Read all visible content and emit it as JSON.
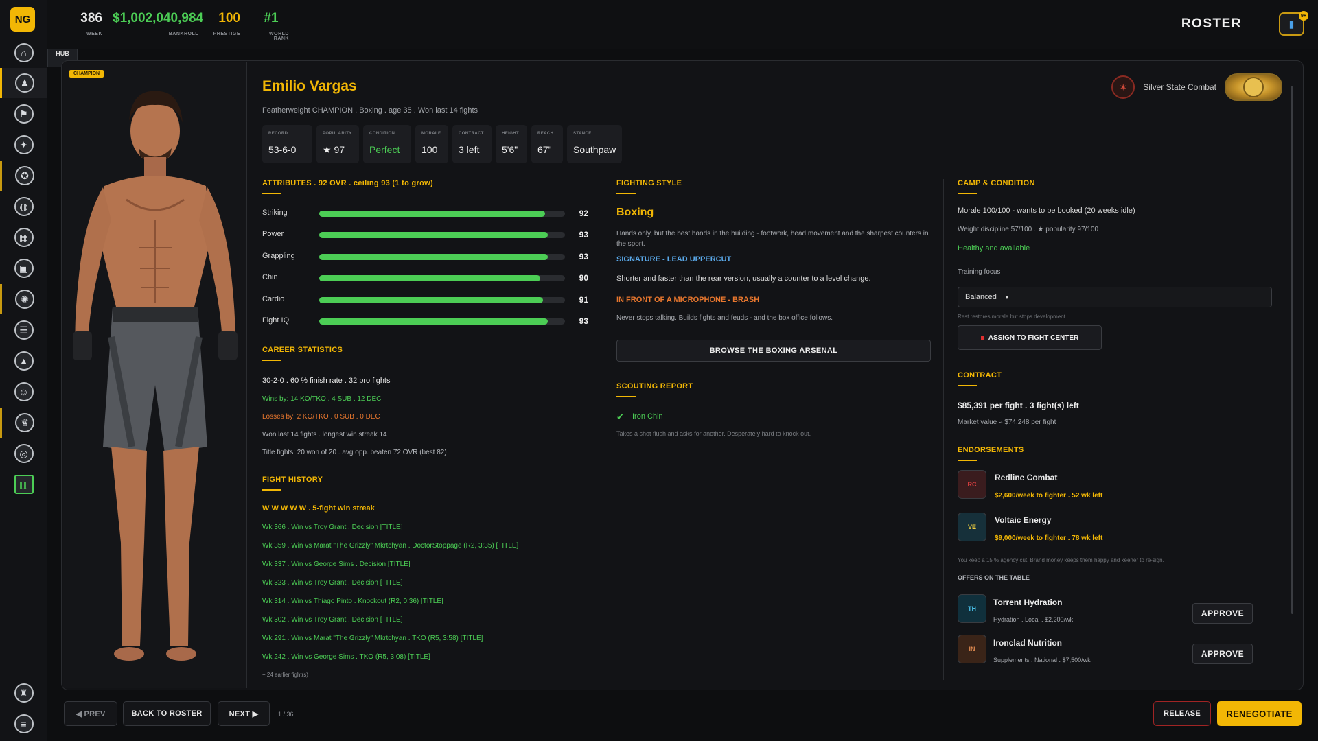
{
  "app": {
    "logo": "NG"
  },
  "topbar": {
    "stats": [
      {
        "value": "386",
        "label": "WEEK",
        "color": "#f0f0f0"
      },
      {
        "value": "$1,002,040,984",
        "label": "BANKROLL",
        "color": "#4ccd55"
      },
      {
        "value": "100",
        "label": "PRESTIGE",
        "color": "#f2b705"
      },
      {
        "value": "#1",
        "label": "WORLD RANK",
        "color": "#4ccd55"
      }
    ],
    "page_title": "ROSTER",
    "roster_badge": "9+"
  },
  "sidebar": {
    "hub_tooltip": "HUB",
    "items": [
      "hub",
      "roster",
      "gym",
      "fighters",
      "events",
      "world",
      "facilities",
      "media",
      "sponsors",
      "rankings",
      "stats",
      "staff",
      "trophies",
      "records",
      "analytics",
      "office",
      "menu"
    ]
  },
  "fighter": {
    "champion_tag": "CHAMPION",
    "name": "Emilio Vargas",
    "subtitle": "Featherweight CHAMPION . Boxing . age 35 . Won last 14 fights",
    "badges": [
      {
        "label": "RECORD",
        "value": "53-6-0"
      },
      {
        "label": "POPULARITY",
        "value": "★ 97"
      },
      {
        "label": "CONDITION",
        "value": "Perfect"
      },
      {
        "label": "MORALE",
        "value": "100"
      },
      {
        "label": "CONTRACT",
        "value": "3 left"
      },
      {
        "label": "HEIGHT",
        "value": "5'6\""
      },
      {
        "label": "REACH",
        "value": "67\""
      },
      {
        "label": "STANCE",
        "value": "Southpaw"
      }
    ],
    "org": "Silver State Combat"
  },
  "attributes": {
    "title": "ATTRIBUTES . 92 OVR . ceiling 93 (1 to grow)",
    "rows": [
      {
        "name": "Striking",
        "value": "92",
        "pct": 92
      },
      {
        "name": "Power",
        "value": "93",
        "pct": 93
      },
      {
        "name": "Grappling",
        "value": "93",
        "pct": 93
      },
      {
        "name": "Chin",
        "value": "90",
        "pct": 90
      },
      {
        "name": "Cardio",
        "value": "91",
        "pct": 91
      },
      {
        "name": "Fight IQ",
        "value": "93",
        "pct": 93
      }
    ]
  },
  "career": {
    "title": "CAREER STATISTICS",
    "line1": "30-2-0 . 60 % finish rate . 32 pro fights",
    "wins": "Wins by: 14 KO/TKO . 4 SUB . 12 DEC",
    "losses": "Losses by: 2 KO/TKO . 0 SUB . 0 DEC",
    "streak": "Won last 14 fights . longest win streak 14",
    "titles": "Title fights: 20 won of 20 . avg opp. beaten 72 OVR (best 82)"
  },
  "history": {
    "title": "FIGHT HISTORY",
    "summary": "W W W W W . 5-fight win streak",
    "fights": [
      "Wk 366 . Win vs Troy Grant . Decision [TITLE]",
      "Wk 359 . Win vs Marat \"The Grizzly\" Mkrtchyan . DoctorStoppage (R2, 3:35) [TITLE]",
      "Wk 337 . Win vs George Sims . Decision [TITLE]",
      "Wk 323 . Win vs Troy Grant . Decision [TITLE]",
      "Wk 314 . Win vs Thiago Pinto . Knockout (R2, 0:36) [TITLE]",
      "Wk 302 . Win vs Troy Grant . Decision [TITLE]",
      "Wk 291 . Win vs Marat \"The Grizzly\" Mkrtchyan . TKO (R5, 3:58) [TITLE]",
      "Wk 242 . Win vs George Sims . TKO (R5, 3:08) [TITLE]"
    ],
    "more": "+ 24 earlier fight(s)"
  },
  "style": {
    "title": "FIGHTING STYLE",
    "name": "Boxing",
    "desc": "Hands only, but the best hands in the building - footwork, head movement and the sharpest counters in the sport.",
    "signature_title": "SIGNATURE - LEAD UPPERCUT",
    "signature_desc": "Shorter and faster than the rear version, usually a counter to a level change.",
    "trait_title": "IN FRONT OF A MICROPHONE - BRASH",
    "trait_desc": "Never stops talking. Builds fights and feuds - and the box office follows.",
    "arsenal_button": "BROWSE THE BOXING ARSENAL"
  },
  "scouting": {
    "title": "SCOUTING REPORT",
    "trait": "Iron Chin",
    "trait_desc": "Takes a shot flush and asks for another. Desperately hard to knock out."
  },
  "camp": {
    "title": "CAMP & CONDITION",
    "morale": "Morale 100/100 - wants to be booked (20 weeks idle)",
    "weight": "Weight discipline 57/100 . ★ popularity 97/100",
    "health": "Healthy and available",
    "training_label": "Training focus",
    "training_value": "Balanced",
    "rest_note": "Rest restores morale but stops development.",
    "assign_button": "ASSIGN TO FIGHT CENTER"
  },
  "contract": {
    "title": "CONTRACT",
    "terms": "$85,391 per fight . 3 fight(s) left",
    "market": "Market value ≈ $74,248 per fight"
  },
  "endorsements": {
    "title": "ENDORSEMENTS",
    "active": [
      {
        "name": "Redline Combat",
        "terms": "$2,600/week to fighter . 52 wk left"
      },
      {
        "name": "Voltaic Energy",
        "terms": "$9,000/week to fighter . 78 wk left"
      }
    ],
    "note": "You keep a 15 % agency cut. Brand money keeps them happy and keener to re-sign.",
    "offers_title": "OFFERS ON THE TABLE",
    "offers": [
      {
        "name": "Torrent Hydration",
        "terms": "Hydration . Local . $2,200/wk",
        "button": "APPROVE"
      },
      {
        "name": "Ironclad Nutrition",
        "terms": "Supplements . National . $7,500/wk",
        "button": "APPROVE"
      }
    ]
  },
  "footer": {
    "prev": "◀ PREV",
    "back": "BACK TO ROSTER",
    "next": "NEXT ▶",
    "page": "1 / 36",
    "release": "RELEASE",
    "renegotiate": "RENEGOTIATE"
  }
}
